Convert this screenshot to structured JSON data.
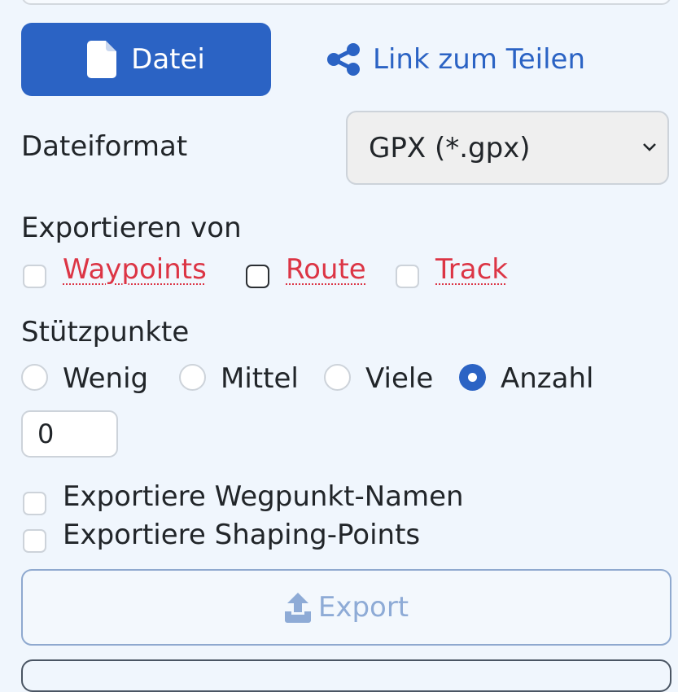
{
  "actions": {
    "file_button": "Datei",
    "share_link": "Link zum Teilen"
  },
  "format": {
    "label": "Dateiformat",
    "selected": "GPX (*.gpx)"
  },
  "export_of": {
    "label": "Exportieren von",
    "options": [
      "Waypoints",
      "Route",
      "Track"
    ],
    "checked": [
      false,
      false,
      false
    ]
  },
  "support_points": {
    "label": "Stützpunkte",
    "options": [
      "Wenig",
      "Mittel",
      "Viele",
      "Anzahl"
    ],
    "selected": "Anzahl",
    "count_value": "0"
  },
  "extra_options": {
    "waypoint_names": "Exportiere Wegpunkt-Namen",
    "shaping_points": "Exportiere Shaping-Points"
  },
  "export_button": "Export",
  "colors": {
    "primary": "#2b63c4",
    "link_red": "#dc3545",
    "background": "#f0f6fd",
    "disabled": "#8eabd6"
  }
}
